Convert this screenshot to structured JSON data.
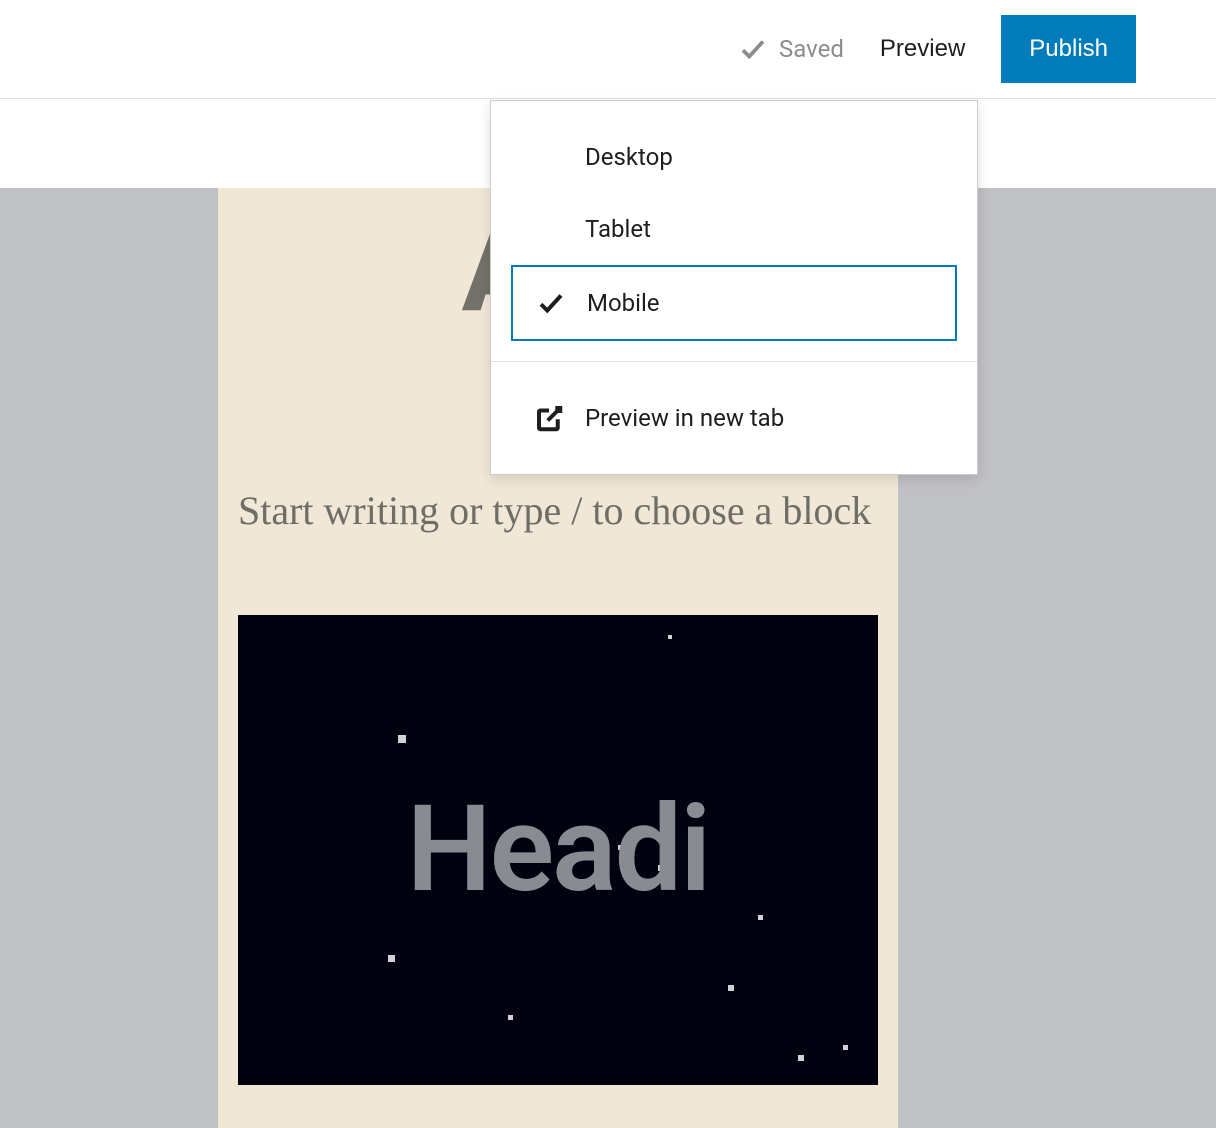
{
  "toolbar": {
    "saved_label": "Saved",
    "preview_label": "Preview",
    "publish_label": "Publish"
  },
  "preview_menu": {
    "desktop_label": "Desktop",
    "tablet_label": "Tablet",
    "mobile_label": "Mobile",
    "new_tab_label": "Preview in new tab",
    "selected": "mobile"
  },
  "editor": {
    "title_placeholder": "Add",
    "body_placeholder": "Start writing or type / to choose a block",
    "cover_heading": "Headi"
  }
}
